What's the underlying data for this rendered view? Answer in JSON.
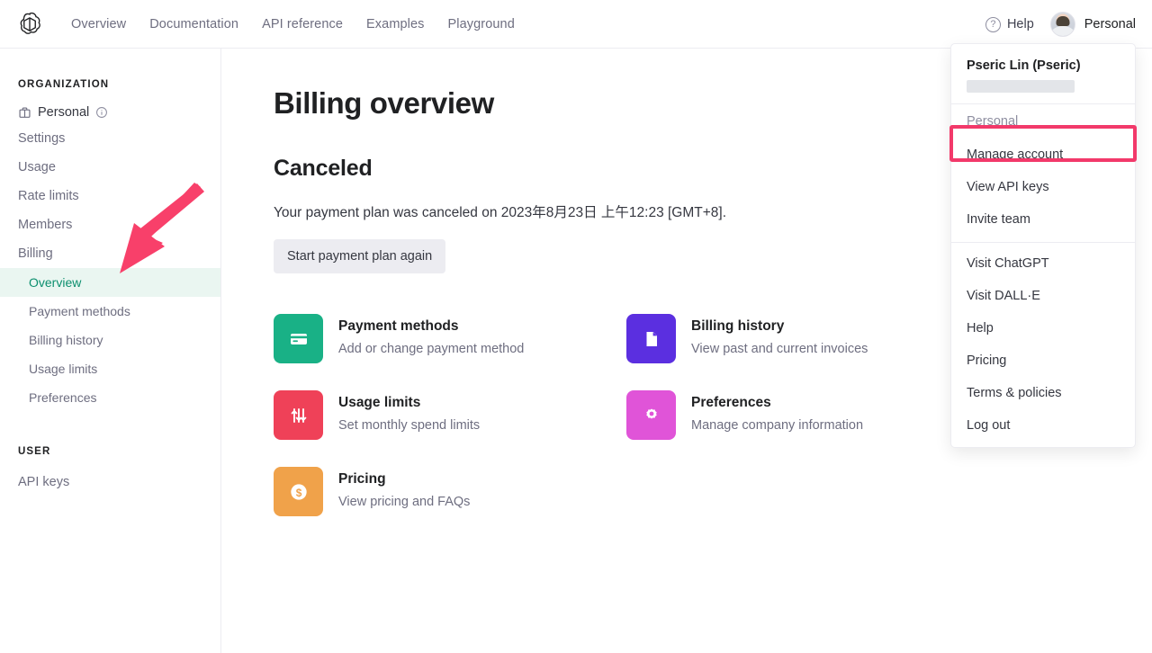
{
  "header": {
    "logo": "openai-logo",
    "nav": [
      {
        "label": "Overview"
      },
      {
        "label": "Documentation"
      },
      {
        "label": "API reference"
      },
      {
        "label": "Examples"
      },
      {
        "label": "Playground"
      }
    ],
    "help_label": "Help",
    "help_icon": "question-circle-icon",
    "account_label": "Personal",
    "avatar": "user-avatar"
  },
  "sidebar": {
    "org_section": "ORGANIZATION",
    "org_name": "Personal",
    "org_icon": "building-icon",
    "org_info_icon": "info-circle-icon",
    "items": [
      {
        "label": "Settings"
      },
      {
        "label": "Usage"
      },
      {
        "label": "Rate limits"
      },
      {
        "label": "Members"
      },
      {
        "label": "Billing"
      }
    ],
    "sub_items": [
      {
        "label": "Overview",
        "active": true
      },
      {
        "label": "Payment methods",
        "active": false
      },
      {
        "label": "Billing history",
        "active": false
      },
      {
        "label": "Usage limits",
        "active": false
      },
      {
        "label": "Preferences",
        "active": false
      }
    ],
    "user_section": "USER",
    "user_items": [
      {
        "label": "API keys"
      }
    ],
    "active_color": "#0c8f6e",
    "active_bg": "#eaf6f1"
  },
  "main": {
    "title": "Billing overview",
    "status_title": "Canceled",
    "status_desc": "Your payment plan was canceled on 2023年8月23日 上午12:23 [GMT+8].",
    "restart_button": "Start payment plan again",
    "tiles": [
      {
        "title": "Payment methods",
        "subtitle": "Add or change payment method",
        "icon": "credit-card-icon",
        "color": "#19b186"
      },
      {
        "title": "Billing history",
        "subtitle": "View past and current invoices",
        "icon": "document-icon",
        "color": "#5b2fe0"
      },
      {
        "title": "Usage limits",
        "subtitle": "Set monthly spend limits",
        "icon": "sliders-icon",
        "color": "#ef4158"
      },
      {
        "title": "Preferences",
        "subtitle": "Manage company information",
        "icon": "gear-icon",
        "color": "#e054d8"
      },
      {
        "title": "Pricing",
        "subtitle": "View pricing and FAQs",
        "icon": "dollar-circle-icon",
        "color": "#f0a24a"
      }
    ]
  },
  "dropdown": {
    "account_name": "Pseric Lin (Pseric)",
    "email_redacted": "",
    "section_label": "Personal",
    "items_group1": [
      {
        "label": "Manage account",
        "highlighted": true
      },
      {
        "label": "View API keys",
        "highlighted": false
      },
      {
        "label": "Invite team",
        "highlighted": false
      }
    ],
    "items_group2": [
      {
        "label": "Visit ChatGPT"
      },
      {
        "label": "Visit DALL·E"
      },
      {
        "label": "Help"
      },
      {
        "label": "Pricing"
      },
      {
        "label": "Terms & policies"
      },
      {
        "label": "Log out"
      }
    ]
  },
  "annotations": {
    "arrow_color": "#f8406a",
    "highlight_color": "#f2396a",
    "arrow_target": "sidebar-overview",
    "highlight_target": "manage-account"
  }
}
